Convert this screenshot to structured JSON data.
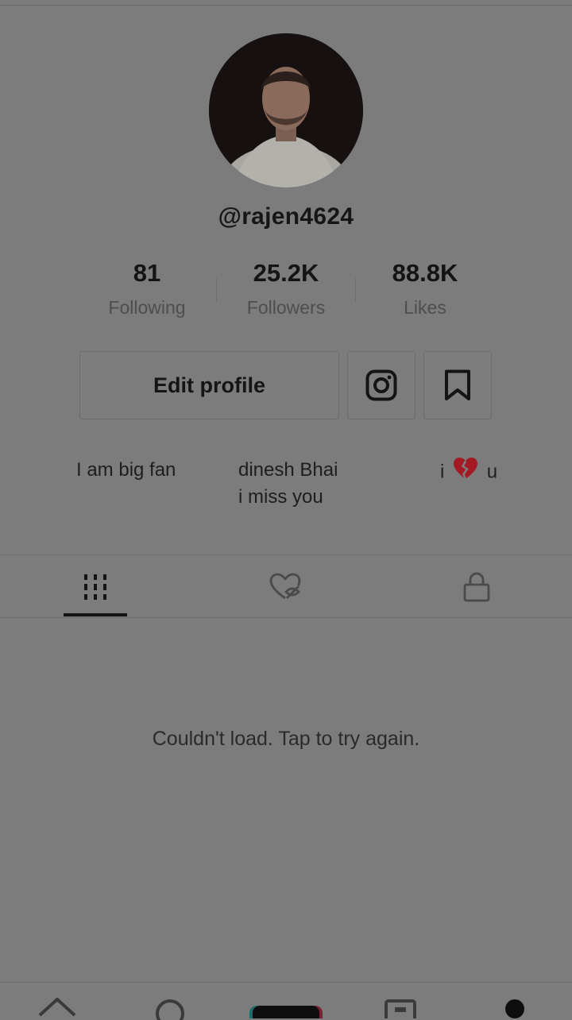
{
  "profile": {
    "username": "@rajen4624",
    "avatar_icon": "profile-photo"
  },
  "stats": [
    {
      "value": "81",
      "label": "Following"
    },
    {
      "value": "25.2K",
      "label": "Followers"
    },
    {
      "value": "88.8K",
      "label": "Likes"
    }
  ],
  "actions": {
    "edit_profile_label": "Edit profile",
    "instagram_icon": "instagram-icon",
    "bookmark_icon": "bookmark-icon"
  },
  "bio": {
    "part1": "I am big fan",
    "part2_line1": "dinesh Bhai",
    "part2_line2": "i miss you",
    "part3_prefix": "i",
    "part3_emoji": "💔",
    "part3_suffix": "u"
  },
  "tabs": [
    {
      "icon": "grid-icon",
      "active": true
    },
    {
      "icon": "liked-hidden-icon",
      "active": false
    },
    {
      "icon": "lock-icon",
      "active": false
    }
  ],
  "content": {
    "error_message": "Couldn't load. Tap to try again."
  },
  "bottom_nav": [
    "home-icon",
    "search-icon",
    "create-icon",
    "inbox-icon",
    "profile-icon"
  ],
  "colors": {
    "overlay_background": "#7c7c7c",
    "text": "#1b1b1b",
    "create_cyan": "#25f4ee",
    "create_pink": "#fe2c55"
  }
}
